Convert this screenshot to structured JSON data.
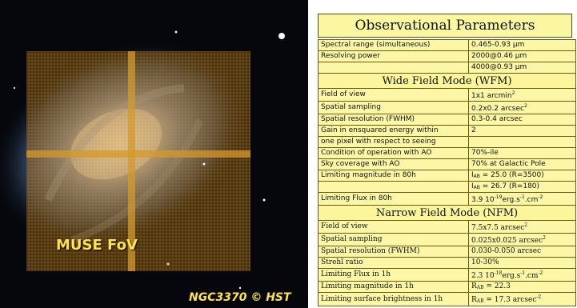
{
  "image": {
    "muse_label": "MUSE FoV",
    "credit": "NGC3370 © HST"
  },
  "table": {
    "title": "Observational Parameters",
    "rows_top": [
      {
        "label": "Spectral range (simultaneous)",
        "value": "0.465-0.93 μm"
      },
      {
        "label": "Resolving power",
        "value": "2000@0.46 μm"
      },
      {
        "label": "",
        "value": "4000@0.93 μm"
      }
    ],
    "wfm_header": "Wide Field Mode (WFM)",
    "wfm_rows": [
      {
        "label": "Field of view",
        "value": "1x1 arcmin",
        "sup": "2"
      },
      {
        "label": "Spatial sampling",
        "value": "0.2x0.2 arcsec",
        "sup": "2"
      },
      {
        "label": "Spatial resolution (FWHM)",
        "value": "0.3-0.4 arcsec"
      },
      {
        "label": "Gain in ensquared energy within",
        "value": "2"
      },
      {
        "label": "one pixel with respect to seeing",
        "value": ""
      },
      {
        "label": "Condition of operation with AO",
        "value": "70%-ile"
      },
      {
        "label": "Sky coverage with AO",
        "value": "70% at Galactic Pole"
      },
      {
        "label": "Limiting magnitude in 80h",
        "value": " = 25.0 (R=3500)",
        "prefix": "I",
        "sub": "AB"
      },
      {
        "label": "",
        "value": " = 26.7 (R=180)",
        "prefix": "I",
        "sub": "AB"
      },
      {
        "label": "Limiting Flux in 80h",
        "value": "3.9 10",
        "sup": "-19",
        "suffix": "erg.s",
        "sup2": "-1",
        "suffix2": ".cm",
        "sup3": "-2"
      }
    ],
    "nfm_header": "Narrow Field Mode (NFM)",
    "nfm_rows": [
      {
        "label": "Field of view",
        "value": "7.5x7.5 arcsec",
        "sup": "2"
      },
      {
        "label": "Spatial sampling",
        "value": "0.025x0.025 arcsec",
        "sup": "2"
      },
      {
        "label": "Spatial resolution (FWHM)",
        "value": "0.030-0.050 arcsec"
      },
      {
        "label": "Strehl ratio",
        "value": "10-30%"
      },
      {
        "label": "Limiting Flux in 1h",
        "value": "2.3 10",
        "sup": "-18",
        "suffix": "erg.s",
        "sup2": "-1",
        "suffix2": ".cm",
        "sup3": "-2"
      },
      {
        "label": "Limiting magnitude in 1h",
        "value": " = 22.3",
        "prefix": "R",
        "sub": "AB"
      },
      {
        "label": "Limiting surface brightness in 1h",
        "value": " = 17.3 arcsec",
        "prefix": "R",
        "sub": "AB",
        "sup": "-2"
      }
    ]
  },
  "colors": {
    "table_fill": "#fcf7a6",
    "border": "#6b5a10",
    "label_yellow": "#ffe34a",
    "grid_orange": "#c98a1e"
  }
}
